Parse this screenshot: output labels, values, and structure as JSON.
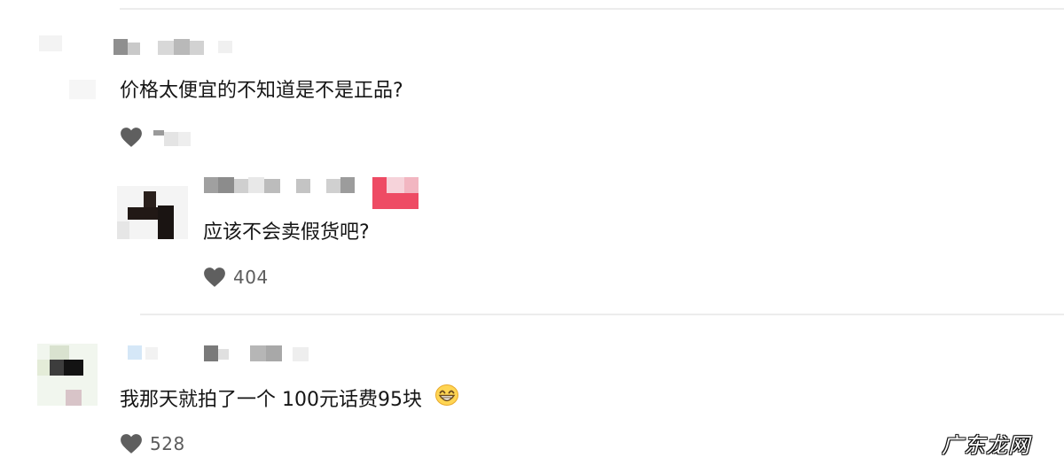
{
  "comments": [
    {
      "text": "价格太便宜的不知道是不是正品?",
      "like_count": "",
      "reply": {
        "text": "应该不会卖假货吧?",
        "like_count": "404"
      }
    },
    {
      "text": "我那天就拍了一个 100元话费95块",
      "emoji": "grinning-face-emoji",
      "like_count": "528"
    }
  ],
  "watermark": "广东龙网",
  "colors": {
    "text": "#161616",
    "like": "#5c5c5c",
    "heart": "#5f5f5f",
    "badge": "#ee4b64",
    "divider": "#ececec"
  },
  "icons": {
    "like": "heart-icon"
  }
}
